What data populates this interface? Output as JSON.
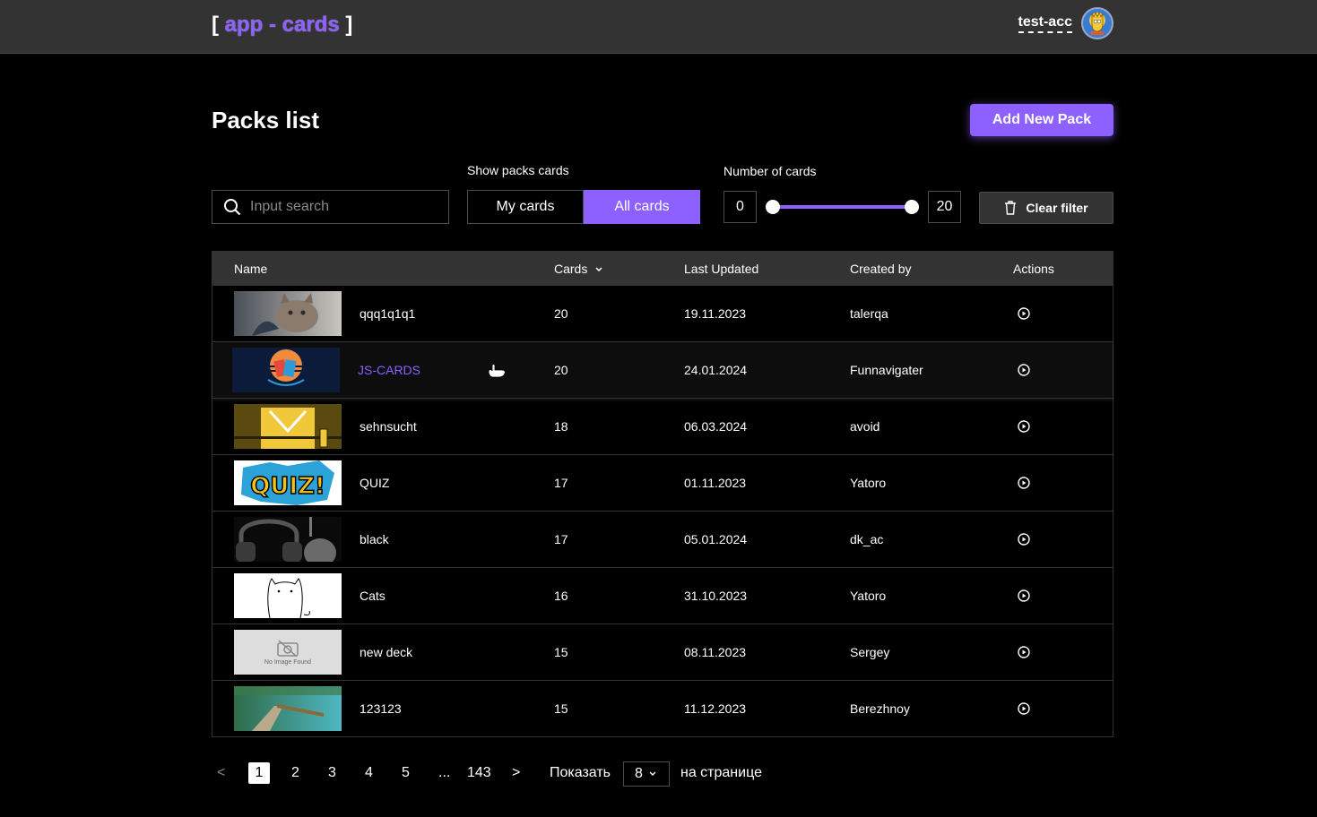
{
  "header": {
    "logo_open": "[",
    "logo_main": "app - cards",
    "logo_close": "]",
    "username": "test-acc",
    "avatar_icon": "simpson-avatar"
  },
  "page": {
    "title": "Packs list",
    "add_button": "Add New Pack"
  },
  "filters": {
    "search_placeholder": "Input search",
    "show_label": "Show packs cards",
    "my_cards": "My cards",
    "all_cards": "All cards",
    "active_toggle": "All cards",
    "number_label": "Number of cards",
    "min": "0",
    "max": "20",
    "slider_range": [
      0,
      20
    ],
    "clear_label": "Clear filter"
  },
  "table": {
    "headers": {
      "name": "Name",
      "cards": "Cards",
      "updated": "Last Updated",
      "created": "Created by",
      "actions": "Actions"
    },
    "rows": [
      {
        "name": "qqq1q1q1",
        "cards": "20",
        "updated": "19.11.2023",
        "created": "talerqa",
        "thumb": "cat-photo"
      },
      {
        "name": "JS-CARDS",
        "cards": "20",
        "updated": "24.01.2024",
        "created": "Funnavigater",
        "thumb": "cards-sunset"
      },
      {
        "name": "sehnsucht",
        "cards": "18",
        "updated": "06.03.2024",
        "created": "avoid",
        "thumb": "yellow-character"
      },
      {
        "name": "QUIZ",
        "cards": "17",
        "updated": "01.11.2023",
        "created": "Yatoro",
        "thumb": "quiz-comic"
      },
      {
        "name": "black",
        "cards": "17",
        "updated": "05.01.2024",
        "created": "dk_ac",
        "thumb": "headphones"
      },
      {
        "name": "Cats",
        "cards": "16",
        "updated": "31.10.2023",
        "created": "Yatoro",
        "thumb": "cat-drawing"
      },
      {
        "name": "new deck",
        "cards": "15",
        "updated": "08.11.2023",
        "created": "Sergey",
        "thumb": "no-image",
        "thumb_text": "No Image Found"
      },
      {
        "name": "123123",
        "cards": "15",
        "updated": "11.12.2023",
        "created": "Berezhnoy",
        "thumb": "landscape"
      }
    ]
  },
  "pagination": {
    "prev": "<",
    "pages": [
      "1",
      "2",
      "3",
      "4",
      "5"
    ],
    "ellipsis": "...",
    "last": "143",
    "next": ">",
    "current": "1",
    "show_label": "Показать",
    "per_page": "8",
    "per_page_suffix": "на странице"
  },
  "colors": {
    "accent": "#8c61ff",
    "header_bg": "#333333",
    "background": "#000000"
  }
}
